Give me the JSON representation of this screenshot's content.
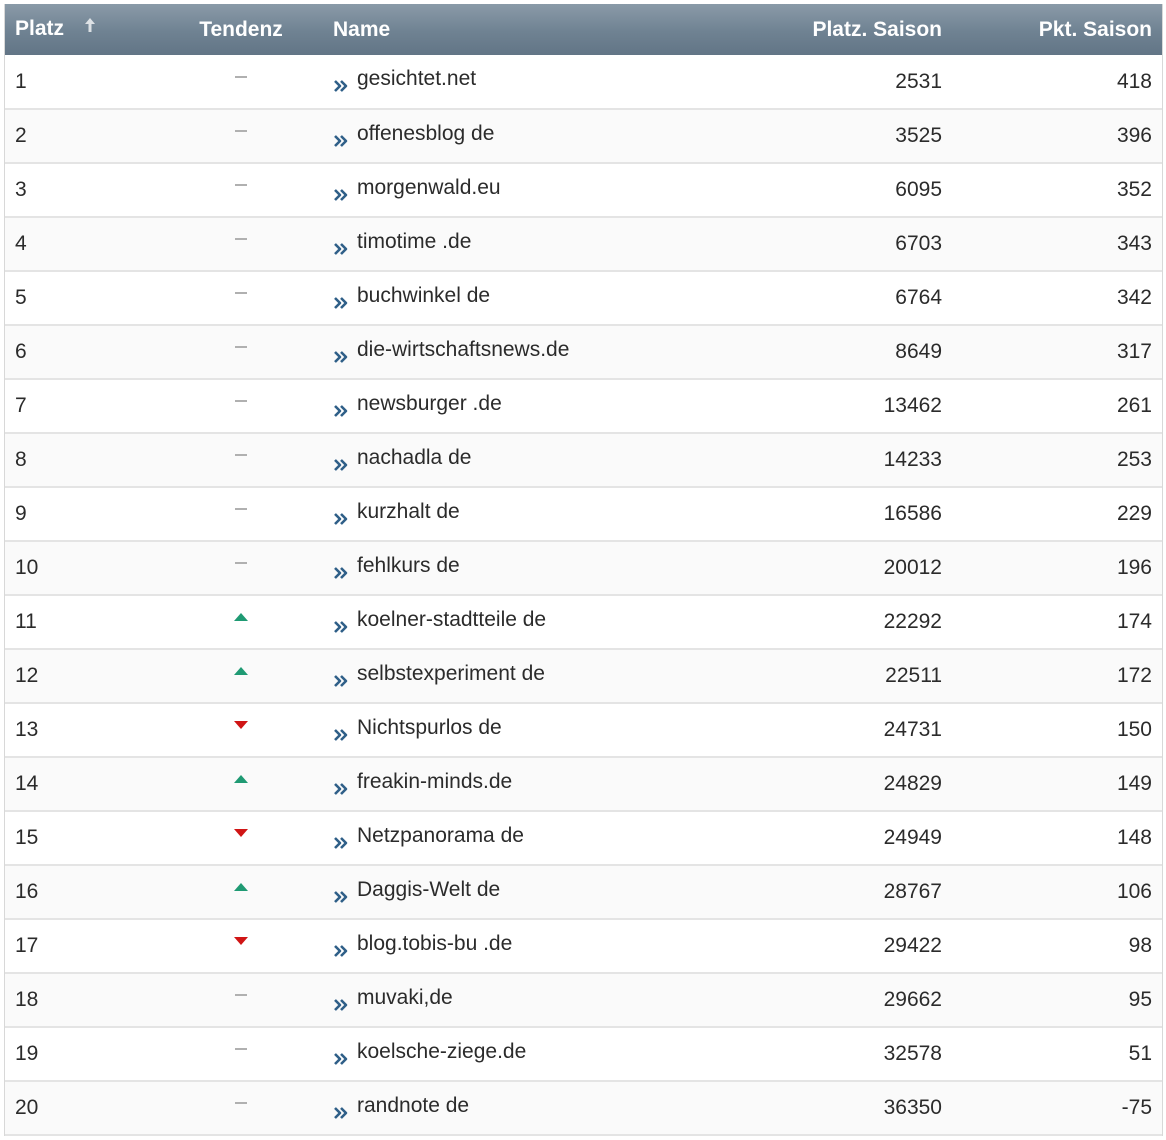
{
  "table": {
    "headers": {
      "platz": "Platz",
      "tendenz": "Tendenz",
      "name": "Name",
      "platz_saison": "Platz. Saison",
      "pkt_saison": "Pkt. Saison"
    },
    "sort_icon": "sort-up-arrow-icon",
    "colors": {
      "header_bg": "#6f8292",
      "trend_up": "#1f9a73",
      "trend_down": "#d01515",
      "trend_same": "#b0b0b0",
      "chevron": "#2f5f88"
    },
    "rows": [
      {
        "platz": "1",
        "trend": "same",
        "name": "gesichtet.net",
        "platz_saison": "2531",
        "pkt_saison": "418"
      },
      {
        "platz": "2",
        "trend": "same",
        "name": "offenesblog de",
        "platz_saison": "3525",
        "pkt_saison": "396"
      },
      {
        "platz": "3",
        "trend": "same",
        "name": "morgenwald.eu",
        "platz_saison": "6095",
        "pkt_saison": "352"
      },
      {
        "platz": "4",
        "trend": "same",
        "name": "timotime .de",
        "platz_saison": "6703",
        "pkt_saison": "343"
      },
      {
        "platz": "5",
        "trend": "same",
        "name": "buchwinkel de",
        "platz_saison": "6764",
        "pkt_saison": "342"
      },
      {
        "platz": "6",
        "trend": "same",
        "name": "die-wirtschaftsnews.de",
        "platz_saison": "8649",
        "pkt_saison": "317"
      },
      {
        "platz": "7",
        "trend": "same",
        "name": "newsburger .de",
        "platz_saison": "13462",
        "pkt_saison": "261"
      },
      {
        "platz": "8",
        "trend": "same",
        "name": "nachadla de",
        "platz_saison": "14233",
        "pkt_saison": "253"
      },
      {
        "platz": "9",
        "trend": "same",
        "name": "kurzhalt de",
        "platz_saison": "16586",
        "pkt_saison": "229"
      },
      {
        "platz": "10",
        "trend": "same",
        "name": "fehlkurs de",
        "platz_saison": "20012",
        "pkt_saison": "196"
      },
      {
        "platz": "11",
        "trend": "up",
        "name": "koelner-stadtteile de",
        "platz_saison": "22292",
        "pkt_saison": "174"
      },
      {
        "platz": "12",
        "trend": "up",
        "name": "selbstexperiment de",
        "platz_saison": "22511",
        "pkt_saison": "172"
      },
      {
        "platz": "13",
        "trend": "down",
        "name": "Nichtspurlos de",
        "platz_saison": "24731",
        "pkt_saison": "150"
      },
      {
        "platz": "14",
        "trend": "up",
        "name": "freakin-minds.de",
        "platz_saison": "24829",
        "pkt_saison": "149"
      },
      {
        "platz": "15",
        "trend": "down",
        "name": "Netzpanorama de",
        "platz_saison": "24949",
        "pkt_saison": "148"
      },
      {
        "platz": "16",
        "trend": "up",
        "name": "Daggis-Welt de",
        "platz_saison": "28767",
        "pkt_saison": "106"
      },
      {
        "platz": "17",
        "trend": "down",
        "name": "blog.tobis-bu .de",
        "platz_saison": "29422",
        "pkt_saison": "98"
      },
      {
        "platz": "18",
        "trend": "same",
        "name": "muvaki,de",
        "platz_saison": "29662",
        "pkt_saison": "95"
      },
      {
        "platz": "19",
        "trend": "same",
        "name": "koelsche-ziege.de",
        "platz_saison": "32578",
        "pkt_saison": "51"
      },
      {
        "platz": "20",
        "trend": "same",
        "name": "randnote de",
        "platz_saison": "36350",
        "pkt_saison": "-75"
      }
    ]
  }
}
